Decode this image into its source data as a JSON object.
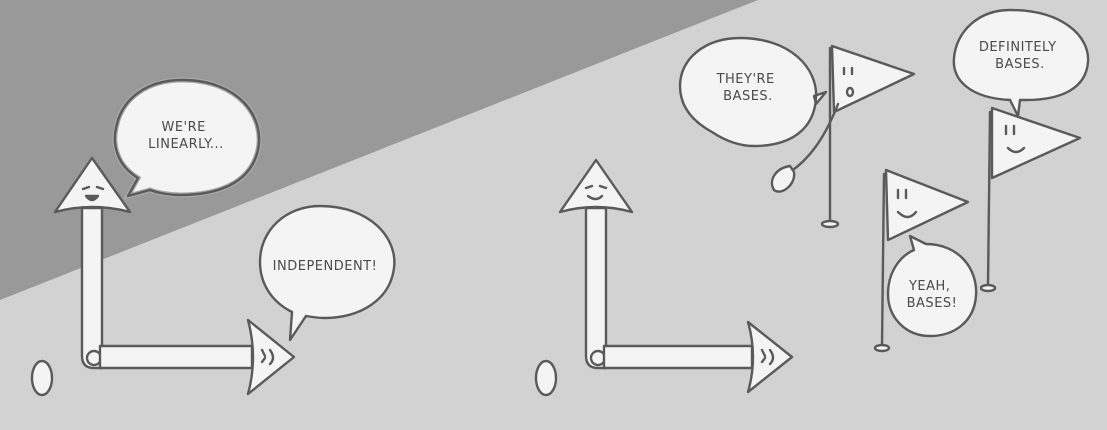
{
  "bubbles": {
    "left_top": [
      "WE'RE",
      "LINEARLY..."
    ],
    "left_right": [
      "INDEPENDENT!"
    ],
    "flag_left": [
      "THEY'RE",
      "BASES."
    ],
    "flag_top": [
      "DEFINITELY",
      "BASES."
    ],
    "flag_bottom": [
      "YEAH,",
      "BASES!"
    ]
  },
  "colors": {
    "background_light": "#d2d2d2",
    "background_dark": "#999999",
    "shape_fill": "#f4f4f4",
    "outline": "#5a5a5a"
  }
}
